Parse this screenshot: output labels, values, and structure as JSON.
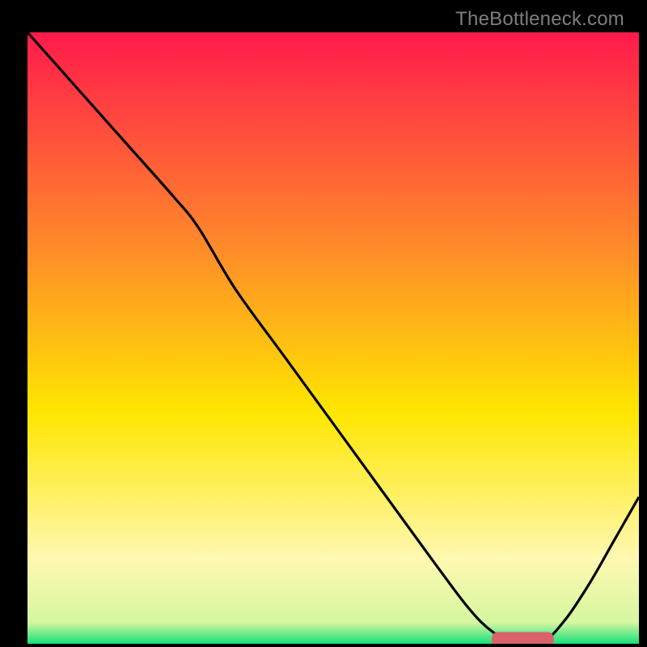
{
  "watermark": "TheBottleneck.com",
  "colors": {
    "gradient_top": "#ff1a4b",
    "gradient_mid1": "#ff8a2a",
    "gradient_mid2": "#ffe600",
    "gradient_pale": "#fff8b0",
    "gradient_bottom": "#16e07a",
    "line": "#000000",
    "marker_fill": "#d9626b",
    "marker_stroke": "#d9626b",
    "frame": "#000000"
  },
  "chart_data": {
    "type": "line",
    "title": "",
    "xlabel": "",
    "ylabel": "",
    "xlim": [
      0,
      100
    ],
    "ylim": [
      0,
      100
    ],
    "series": [
      {
        "name": "bottleneck-curve",
        "x": [
          0,
          8,
          16,
          24,
          28,
          34,
          42,
          50,
          58,
          66,
          72,
          76,
          80,
          84,
          88,
          92,
          96,
          100
        ],
        "y": [
          100,
          91,
          82,
          73,
          68,
          58,
          47,
          36,
          25,
          14,
          6,
          2,
          0,
          0,
          4,
          10,
          17,
          24
        ]
      }
    ],
    "marker": {
      "x_center": 81,
      "y_center": 0.7,
      "width": 10,
      "height": 2.3,
      "shape": "rounded-rect"
    },
    "background": {
      "type": "vertical-gradient",
      "stops": [
        {
          "offset": 0.0,
          "color": "#ff1a4b"
        },
        {
          "offset": 0.35,
          "color": "#ff8a2a"
        },
        {
          "offset": 0.62,
          "color": "#ffe600"
        },
        {
          "offset": 0.86,
          "color": "#fff8b0"
        },
        {
          "offset": 0.965,
          "color": "#d6f7a0"
        },
        {
          "offset": 1.0,
          "color": "#16e07a"
        }
      ]
    }
  }
}
